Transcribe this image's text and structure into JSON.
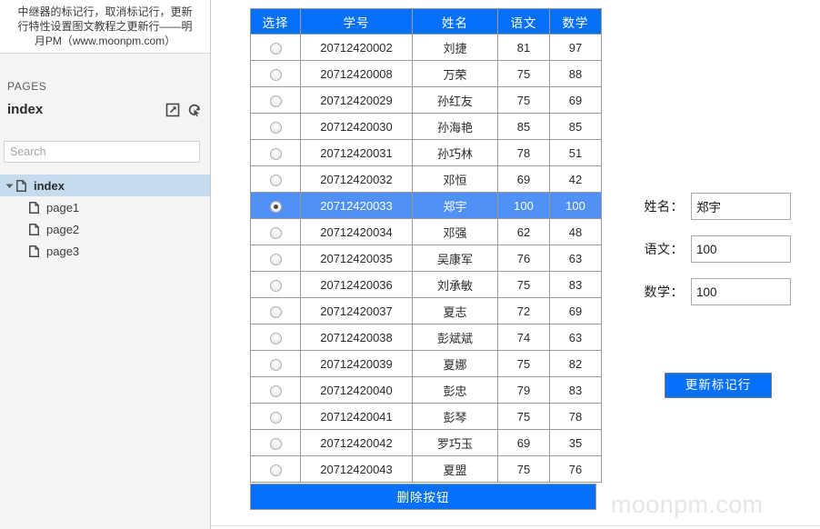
{
  "left_panel": {
    "caption": "中继器的标记行，取消标记行，更新\n行特性设置图文教程之更新行——明\n月PM（www.moonpm.com）",
    "pages_label": "PAGES",
    "index_title": "index",
    "icons": {
      "open_in_new": "open-in-new-icon",
      "reload": "reload-cursor-icon"
    },
    "search": {
      "placeholder": "Search",
      "value": ""
    },
    "tree": [
      {
        "label": "index",
        "level": 0,
        "selected": true,
        "expanded": true
      },
      {
        "label": "page1",
        "level": 1,
        "selected": false
      },
      {
        "label": "page2",
        "level": 1,
        "selected": false
      },
      {
        "label": "page3",
        "level": 1,
        "selected": false
      }
    ]
  },
  "table": {
    "headers": [
      "选择",
      "学号",
      "姓名",
      "语文",
      "数学"
    ],
    "rows": [
      {
        "id": "20712420002",
        "name": "刘捷",
        "chinese": "81",
        "math": "97",
        "selected": false
      },
      {
        "id": "20712420008",
        "name": "万荣",
        "chinese": "75",
        "math": "88",
        "selected": false
      },
      {
        "id": "20712420029",
        "name": "孙红友",
        "chinese": "75",
        "math": "69",
        "selected": false
      },
      {
        "id": "20712420030",
        "name": "孙海艳",
        "chinese": "85",
        "math": "85",
        "selected": false
      },
      {
        "id": "20712420031",
        "name": "孙巧林",
        "chinese": "78",
        "math": "51",
        "selected": false
      },
      {
        "id": "20712420032",
        "name": "邓恒",
        "chinese": "69",
        "math": "42",
        "selected": false
      },
      {
        "id": "20712420033",
        "name": "郑宇",
        "chinese": "100",
        "math": "100",
        "selected": true
      },
      {
        "id": "20712420034",
        "name": "邓强",
        "chinese": "62",
        "math": "48",
        "selected": false
      },
      {
        "id": "20712420035",
        "name": "吴康军",
        "chinese": "76",
        "math": "63",
        "selected": false
      },
      {
        "id": "20712420036",
        "name": "刘承敏",
        "chinese": "75",
        "math": "83",
        "selected": false
      },
      {
        "id": "20712420037",
        "name": "夏志",
        "chinese": "72",
        "math": "69",
        "selected": false
      },
      {
        "id": "20712420038",
        "name": "彭斌斌",
        "chinese": "74",
        "math": "63",
        "selected": false
      },
      {
        "id": "20712420039",
        "name": "夏娜",
        "chinese": "75",
        "math": "82",
        "selected": false
      },
      {
        "id": "20712420040",
        "name": "彭忠",
        "chinese": "79",
        "math": "83",
        "selected": false
      },
      {
        "id": "20712420041",
        "name": "彭琴",
        "chinese": "75",
        "math": "78",
        "selected": false
      },
      {
        "id": "20712420042",
        "name": "罗巧玉",
        "chinese": "69",
        "math": "35",
        "selected": false
      },
      {
        "id": "20712420043",
        "name": "夏盟",
        "chinese": "75",
        "math": "76",
        "selected": false
      }
    ],
    "delete_button_label": "删除按钮"
  },
  "form": {
    "fields": [
      {
        "label": "姓名：",
        "value": "郑宇",
        "name": "name"
      },
      {
        "label": "语文：",
        "value": "100",
        "name": "chinese"
      },
      {
        "label": "数学：",
        "value": "100",
        "name": "math"
      }
    ],
    "update_button_label": "更新标记行"
  },
  "watermark": "moonpm.com",
  "colors": {
    "header_blue": "#0670fb",
    "selected_row_blue": "#4f91f5",
    "tree_selected": "#c5dcef",
    "panel_bg": "#f4f4f4",
    "watermark": "#e3e6ea"
  }
}
